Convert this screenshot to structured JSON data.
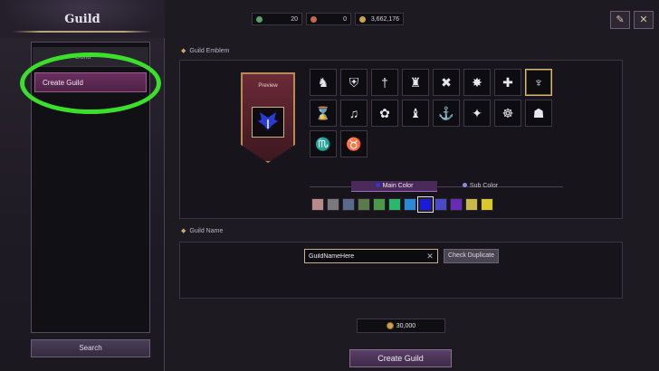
{
  "sidebar": {
    "title": "Guild",
    "list_item": "Guild",
    "create_item": "Create Guild",
    "search_label": "Search"
  },
  "resources": [
    {
      "name": "resource-1",
      "value": "20",
      "color": "#5aa06a"
    },
    {
      "name": "resource-2",
      "value": "0",
      "color": "#c86a4a"
    },
    {
      "name": "gold",
      "value": "3,662,176",
      "color": "#c9a54a"
    }
  ],
  "top_icons": [
    {
      "name": "journal-icon",
      "glyph": "✎"
    },
    {
      "name": "close-icon",
      "glyph": "✕"
    }
  ],
  "emblem_section": {
    "label": "Guild Emblem",
    "preview_label": "Preview",
    "icons": [
      {
        "name": "wolf-icon",
        "glyph": "♞"
      },
      {
        "name": "shield-cross-icon",
        "glyph": "⛨"
      },
      {
        "name": "sword-icon",
        "glyph": "†"
      },
      {
        "name": "helmet-icon",
        "glyph": "♜"
      },
      {
        "name": "crossed-axes-icon",
        "glyph": "✖"
      },
      {
        "name": "star-burst-icon",
        "glyph": "✸"
      },
      {
        "name": "cross-icon",
        "glyph": "✚"
      },
      {
        "name": "winged-emblem-icon",
        "glyph": "♆",
        "selected": true
      },
      {
        "name": "hourglass-icon",
        "glyph": "⌛"
      },
      {
        "name": "lyre-icon",
        "glyph": "♫"
      },
      {
        "name": "rose-icon",
        "glyph": "✿"
      },
      {
        "name": "knight-helm-icon",
        "glyph": "♝"
      },
      {
        "name": "anchor-icon",
        "glyph": "⚓"
      },
      {
        "name": "compass-star-icon",
        "glyph": "✦"
      },
      {
        "name": "turtle-icon",
        "glyph": "☸"
      },
      {
        "name": "open-book-icon",
        "glyph": "☗"
      },
      {
        "name": "scorpion-icon",
        "glyph": "♏"
      },
      {
        "name": "ox-skull-icon",
        "glyph": "♉"
      }
    ]
  },
  "color_tabs": {
    "main": "Main Color",
    "sub": "Sub Color",
    "main_dot": "#2a3ad8",
    "sub_dot": "#8a8ae0"
  },
  "swatches": [
    {
      "color": "#b88a8a"
    },
    {
      "color": "#7a7a7e"
    },
    {
      "color": "#5a6a8a"
    },
    {
      "color": "#5a7a4a"
    },
    {
      "color": "#4a9a4a"
    },
    {
      "color": "#2ab86a"
    },
    {
      "color": "#2a8ad8"
    },
    {
      "color": "#1a1ad8",
      "selected": true
    },
    {
      "color": "#4a4ac8"
    },
    {
      "color": "#6a2ab8"
    },
    {
      "color": "#c8b84a"
    },
    {
      "color": "#d8c82a"
    }
  ],
  "name_section": {
    "label": "Guild Name",
    "input_value": "GuildNameHere",
    "check_button": "Check Duplicate"
  },
  "cost": {
    "value": "30,000"
  },
  "create_button": "Create Guild"
}
